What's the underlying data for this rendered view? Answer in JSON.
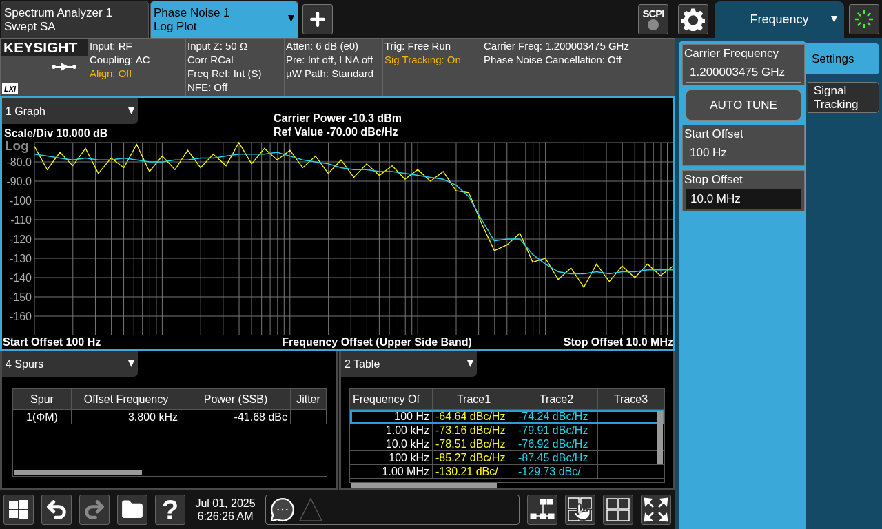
{
  "tabs": [
    {
      "title": "Spectrum Analyzer 1",
      "subtitle": "Swept SA",
      "selected": false
    },
    {
      "title": "Phase Noise 1",
      "subtitle": "Log Plot",
      "selected": true
    }
  ],
  "toolbar": {
    "scpi_label": "SCPI",
    "menu_title": "Frequency"
  },
  "info_bar": {
    "logo": "KEYSIGHT",
    "lxi": "LXI",
    "cells": [
      {
        "lines": [
          {
            "text": "Input: RF",
            "highlight": false
          },
          {
            "text": "Coupling: AC",
            "highlight": false
          },
          {
            "text": "Align: Off",
            "highlight": true
          }
        ]
      },
      {
        "lines": [
          {
            "text": "Input Z: 50 Ω",
            "highlight": false
          },
          {
            "text": "Corr RCal",
            "highlight": false
          },
          {
            "text": "Freq Ref: Int (S)",
            "highlight": false
          },
          {
            "text": "NFE: Off",
            "highlight": false
          }
        ]
      },
      {
        "lines": [
          {
            "text": "Atten: 6 dB (e0)",
            "highlight": false
          },
          {
            "text": "Pre: Int off, LNA off",
            "highlight": false
          },
          {
            "text": "µW Path: Standard",
            "highlight": false
          }
        ]
      },
      {
        "lines": [
          {
            "text": "Trig: Free Run",
            "highlight": false
          },
          {
            "text": "Sig Tracking: On",
            "highlight": true
          }
        ]
      },
      {
        "lines": [
          {
            "text": "Carrier Freq: 1.200003475 GHz",
            "highlight": false
          },
          {
            "text": "Phase Noise Cancellation: Off",
            "highlight": false
          }
        ]
      }
    ]
  },
  "graph": {
    "window_selector": "1 Graph",
    "scale": "Scale/Div 10.000 dB",
    "carrier_power": "Carrier Power -10.3 dBm",
    "ref_value": "Ref Value -70.00 dBc/Hz",
    "scale_type": "Log",
    "start_offset": "Start Offset 100 Hz",
    "stop_offset": "Stop Offset 10.0 MHz",
    "chart_data": {
      "type": "line",
      "grid": true,
      "xlabel": "Frequency Offset (Upper Side Band)",
      "ylim": [
        -170,
        -70
      ],
      "yticks": [
        {
          "value": -80,
          "label": "-80.0"
        },
        {
          "value": -90,
          "label": "-90.0"
        },
        {
          "value": -100,
          "label": "-100"
        },
        {
          "value": -110,
          "label": "-110"
        },
        {
          "value": -120,
          "label": "-120"
        },
        {
          "value": -130,
          "label": "-130"
        },
        {
          "value": -140,
          "label": "-140"
        },
        {
          "value": -150,
          "label": "-150"
        },
        {
          "value": -160,
          "label": "-160"
        }
      ],
      "categories": [
        null,
        null,
        null,
        null,
        null,
        null,
        null,
        null,
        null,
        null,
        null,
        null,
        null,
        null,
        null,
        null,
        null,
        null,
        null,
        null,
        null,
        null,
        null,
        null,
        null,
        null,
        null,
        null,
        null,
        null,
        null,
        null,
        null,
        null,
        null,
        null,
        null,
        null,
        null,
        null,
        null,
        null,
        null,
        null,
        null,
        null,
        null,
        null,
        null,
        null,
        null
      ],
      "series": [
        {
          "color": "#ffff00",
          "values": [
            -72,
            -84,
            -75,
            -82,
            -73,
            -86,
            -78,
            -83,
            -71,
            -85,
            -77,
            -84,
            -74,
            -83,
            -76,
            -82,
            -70,
            -81,
            -73,
            -79,
            -74,
            -83,
            -77,
            -86,
            -79,
            -88,
            -81,
            -87,
            -82,
            -89,
            -84,
            -90,
            -85,
            -95,
            -96,
            -112,
            -126,
            -123,
            -117,
            -132,
            -130,
            -141,
            -135,
            -145,
            -133,
            -142,
            -134,
            -140,
            -133,
            -139,
            -134
          ]
        },
        {
          "color": "#22d3e6",
          "values": [
            -76,
            -77,
            -78,
            -79,
            -78,
            -79,
            -79,
            -78,
            -79,
            -80,
            -80,
            -79,
            -79,
            -78,
            -78,
            -77,
            -76,
            -76,
            -76,
            -75,
            -77,
            -79,
            -80,
            -81,
            -83,
            -84,
            -84,
            -85,
            -85,
            -86,
            -87,
            -88,
            -89,
            -92,
            -98,
            -110,
            -121,
            -120,
            -120,
            -128,
            -133,
            -137,
            -138,
            -138,
            -137,
            -138,
            -137,
            -137,
            -136,
            -136,
            -136
          ]
        }
      ]
    }
  },
  "spurs": {
    "window_selector": "4 Spurs",
    "columns": [
      "Spur",
      "Offset Frequency",
      "Power (SSB)",
      "Jitter"
    ],
    "rows": [
      {
        "cells": [
          "1(ΦM)",
          "3.800 kHz",
          "-41.68 dBc"
        ]
      }
    ]
  },
  "table": {
    "window_selector": "2 Table",
    "columns": [
      {
        "label": "Frequency Of"
      },
      {
        "label": "Trace1",
        "color": "#ffff00"
      },
      {
        "label": "Trace2",
        "color": "#22d3e6"
      },
      {
        "label": "Trace3"
      }
    ],
    "rows": [
      {
        "cells": [
          "100 Hz",
          "-64.64 dBc/Hz",
          "-74.24 dBc/Hz"
        ],
        "selected": true
      },
      {
        "cells": [
          "1.00 kHz",
          "-73.16 dBc/Hz",
          "-79.91 dBc/Hz"
        ],
        "selected": false
      },
      {
        "cells": [
          "10.0 kHz",
          "-78.51 dBc/Hz",
          "-76.92 dBc/Hz"
        ],
        "selected": false
      },
      {
        "cells": [
          "100 kHz",
          "-85.27 dBc/Hz",
          "-87.45 dBc/Hz"
        ],
        "selected": false
      },
      {
        "cells": [
          "1.00 MHz",
          "-130.21 dBc/",
          "-129.73 dBc/"
        ],
        "selected": false
      }
    ]
  },
  "taskbar": {
    "date": "Jul 01, 2025",
    "time": "6:26:26 AM",
    "help_label": "?",
    "left_buttons": [
      {
        "kind": "windows",
        "disabled": false
      },
      {
        "kind": "undo",
        "disabled": false
      },
      {
        "kind": "redo",
        "disabled": true
      },
      {
        "kind": "folder",
        "disabled": false
      },
      {
        "kind": "help",
        "disabled": false
      }
    ],
    "right_buttons": [
      {
        "kind": "network"
      },
      {
        "kind": "touch"
      },
      {
        "kind": "layout"
      },
      {
        "kind": "fullscreen"
      }
    ]
  },
  "menu_panel": {
    "controls": [
      {
        "kind": "field",
        "label": "Carrier Frequency",
        "value": "1.200003475 GHz",
        "active": false
      },
      {
        "kind": "button",
        "label": "AUTO TUNE"
      },
      {
        "kind": "field",
        "label": "Start Offset",
        "value": "100 Hz",
        "active": false
      },
      {
        "kind": "field",
        "label": "Stop Offset",
        "value": "10.0 MHz",
        "active": true
      }
    ],
    "softkeys": [
      {
        "label": "Settings",
        "selected": true
      },
      {
        "label": "Signal Tracking",
        "selected": false
      }
    ]
  }
}
